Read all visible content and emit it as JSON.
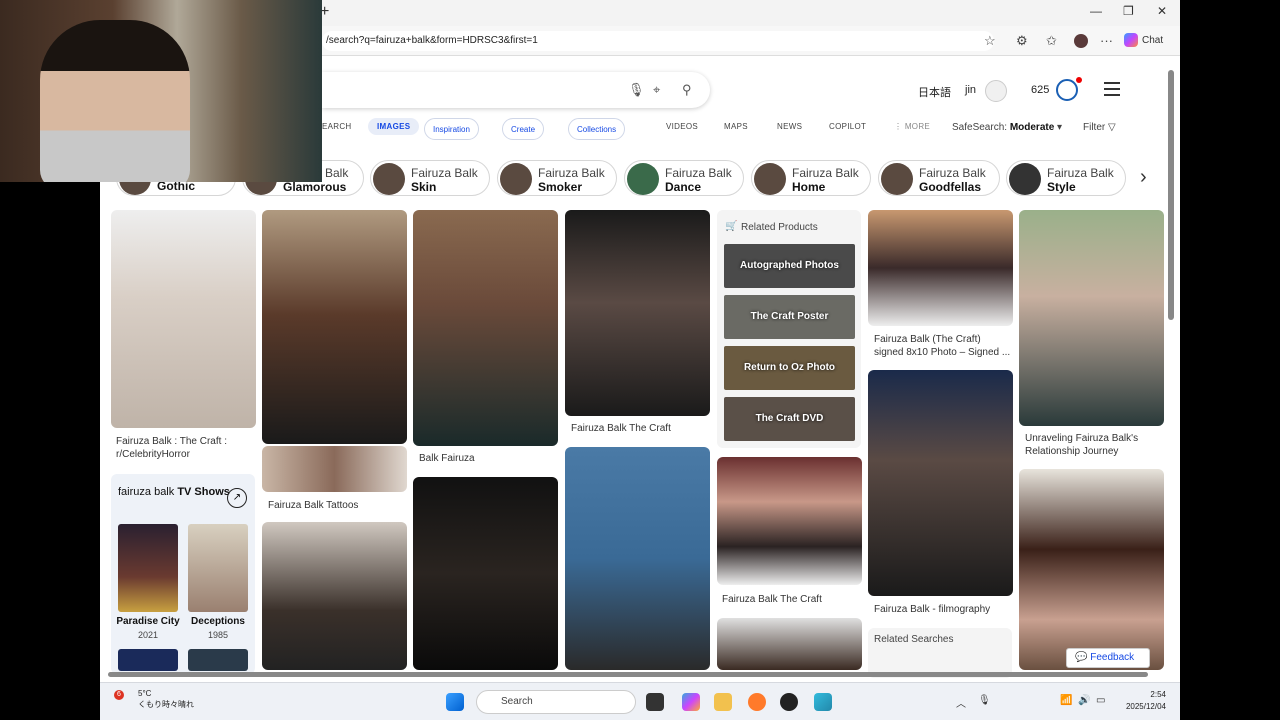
{
  "browser": {
    "url": "/search?q=fairuza+balk&form=HDRSC3&first=1",
    "chat_label": "Chat"
  },
  "header": {
    "language": "日本語",
    "user": "jin",
    "points": "625"
  },
  "nav": {
    "tabs": [
      "EARCH",
      "IMAGES",
      "Inspiration",
      "Create",
      "Collections",
      "VIDEOS",
      "MAPS",
      "NEWS",
      "COPILOT",
      "MORE"
    ],
    "safesearch_label": "SafeSearch:",
    "safesearch_value": "Moderate",
    "filter_label": "Filter"
  },
  "chips": [
    {
      "t1": "",
      "t2": "Gothic"
    },
    {
      "t1": "Balk",
      "t2": "Glamorous"
    },
    {
      "t1": "Fairuza Balk",
      "t2": "Skin"
    },
    {
      "t1": "Fairuza Balk",
      "t2": "Smoker"
    },
    {
      "t1": "Fairuza Balk",
      "t2": "Dance"
    },
    {
      "t1": "Fairuza Balk",
      "t2": "Home"
    },
    {
      "t1": "Fairuza Balk",
      "t2": "Goodfellas"
    },
    {
      "t1": "Fairuza Balk",
      "t2": "Style"
    }
  ],
  "captions": {
    "c1": "Fairuza Balk : The Craft : r/CelebrityHorror",
    "c2": "Fairuza Balk Tattoos",
    "c3": "Balk Fairuza",
    "c4": "Fairuza Balk The Craft",
    "c5": "Fairuza Balk The Craft",
    "c6": "Fairuza Balk (The Craft) signed 8x10 Photo – Signed ...",
    "c7": "Fairuza Balk - filmography",
    "c8": "Unraveling Fairuza Balk's Relationship Journey"
  },
  "related_products": {
    "title": "Related Products",
    "items": [
      "Autographed Photos",
      "The Craft Poster",
      "Return to Oz Photo",
      "The Craft DVD"
    ]
  },
  "tv_shows": {
    "heading_plain": "fairuza balk ",
    "heading_bold": "TV Shows",
    "shows": [
      {
        "name": "Paradise City",
        "year": "2021"
      },
      {
        "name": "Deceptions",
        "year": "1985"
      }
    ]
  },
  "related_searches": {
    "title": "Related Searches"
  },
  "feedback": "Feedback",
  "taskbar": {
    "weather_temp": "5°C",
    "weather_desc": "くもり時々晴れ",
    "weather_badge": "6",
    "search": "Search",
    "time": "2:54",
    "date": "2025/12/04"
  },
  "colors": {
    "accent": "#174ae4",
    "background": "#ffffff"
  }
}
